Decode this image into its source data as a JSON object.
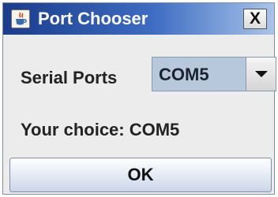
{
  "window": {
    "title": "Port Chooser",
    "icon": "java-cup-icon",
    "close_label": "X"
  },
  "serial": {
    "label": "Serial Ports",
    "selected": "COM5",
    "dropdown_icon": "triangle-down-icon"
  },
  "choice": {
    "text": "Your choice: COM5"
  },
  "actions": {
    "ok_label": "OK"
  }
}
